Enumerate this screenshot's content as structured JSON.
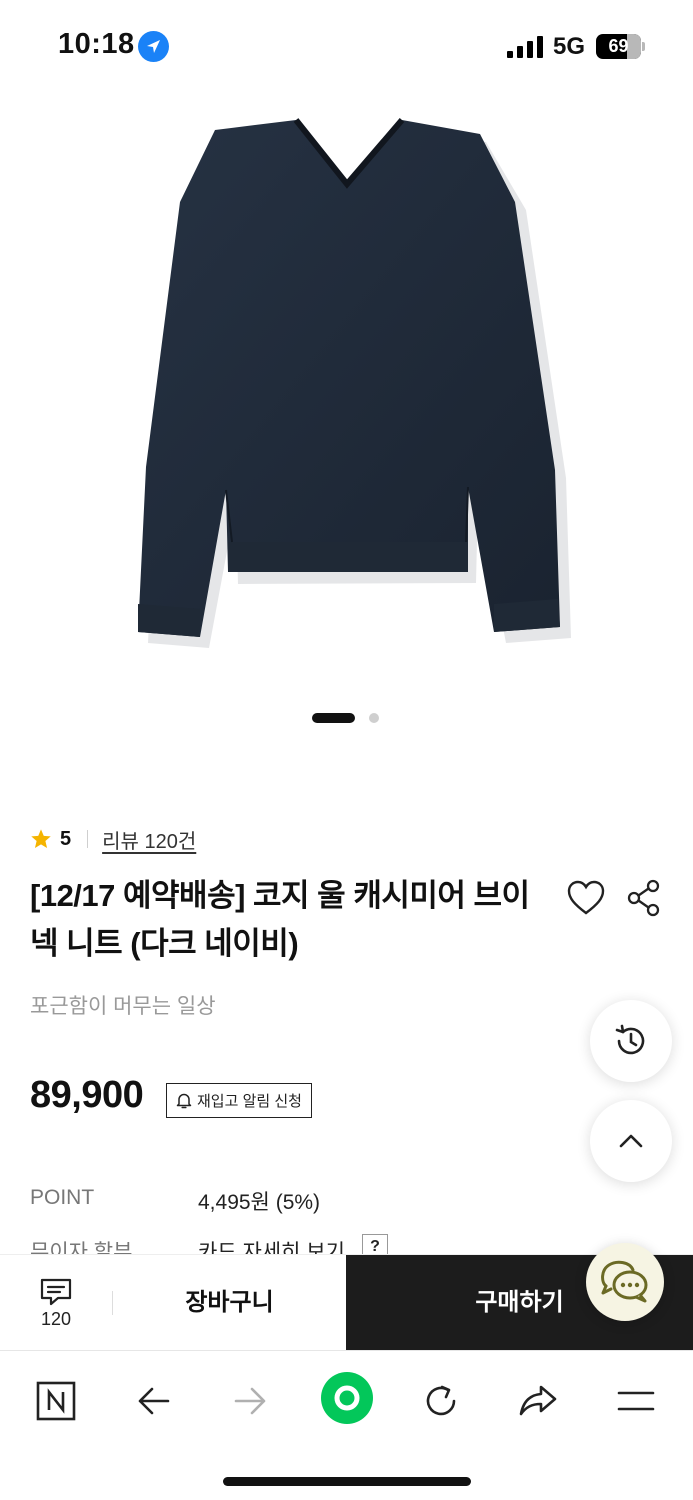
{
  "status_bar": {
    "time": "10:18",
    "network": "5G",
    "battery": "69",
    "icons": [
      "location-arrow-icon",
      "cellular-signal-icon",
      "battery-icon"
    ]
  },
  "gallery": {
    "image_alt": "dark navy v-neck knit sweater",
    "total_slides": 2,
    "active_slide": 1
  },
  "rating": {
    "score": "5",
    "review_link": "리뷰 120건"
  },
  "product": {
    "title": "[12/17 예약배송] 코지 울 캐시미어 브이넥 니트 (다크 네이비)",
    "subtitle": "포근함이 머무는 일상",
    "price": "89,900",
    "restock_label": "재입고 알림 신청"
  },
  "info": {
    "point_label": "POINT",
    "point_value": "4,495원 (5%)",
    "installment_label": "무이자 할부",
    "installment_value": "카드 자세히 보기",
    "help_badge": "?"
  },
  "purchase_bar": {
    "review_count": "120",
    "cart_label": "장바구니",
    "buy_label": "구매하기"
  },
  "colors": {
    "accent_blue": "#1a82f7",
    "star": "#f5b400",
    "naver_green": "#03c75a",
    "sweater_navy": "#1d2836",
    "buy_bg": "#1c1c1c"
  }
}
